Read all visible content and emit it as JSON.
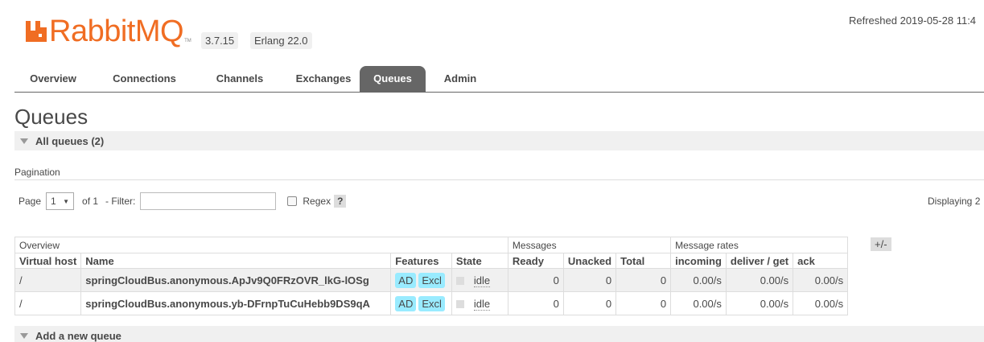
{
  "header": {
    "logo_text": "RabbitMQ",
    "logo_tm": "TM",
    "version": "3.7.15",
    "erlang": "Erlang 22.0",
    "refreshed": "Refreshed 2019-05-28 11:4",
    "brand_color": "#f06d23"
  },
  "tabs": [
    {
      "label": "Overview"
    },
    {
      "label": "Connections"
    },
    {
      "label": "Channels"
    },
    {
      "label": "Exchanges"
    },
    {
      "label": "Queues",
      "active": true
    },
    {
      "label": "Admin"
    }
  ],
  "page": {
    "title": "Queues",
    "all_queues": "All queues (2)",
    "add_queue": "Add a new queue"
  },
  "pagination": {
    "label": "Pagination",
    "page_label": "Page",
    "page_value": "1",
    "of_label": "of 1",
    "filter_label": "- Filter:",
    "filter_value": "",
    "regex_label": "Regex",
    "help": "?",
    "displaying": "Displaying 2"
  },
  "table": {
    "groups": [
      "Overview",
      "Messages",
      "Message rates"
    ],
    "plus_minus": "+/-",
    "columns": [
      "Virtual host",
      "Name",
      "Features",
      "State",
      "Ready",
      "Unacked",
      "Total",
      "incoming",
      "deliver / get",
      "ack"
    ],
    "rows": [
      {
        "vhost": "/",
        "name": "springCloudBus.anonymous.ApJv9Q0FRzOVR_lkG-lOSg",
        "features": [
          "AD",
          "Excl"
        ],
        "state": "idle",
        "ready": "0",
        "unacked": "0",
        "total": "0",
        "incoming": "0.00/s",
        "deliver": "0.00/s",
        "ack": "0.00/s"
      },
      {
        "vhost": "/",
        "name": "springCloudBus.anonymous.yb-DFrnpTuCuHebb9DS9qA",
        "features": [
          "AD",
          "Excl"
        ],
        "state": "idle",
        "ready": "0",
        "unacked": "0",
        "total": "0",
        "incoming": "0.00/s",
        "deliver": "0.00/s",
        "ack": "0.00/s"
      }
    ]
  }
}
